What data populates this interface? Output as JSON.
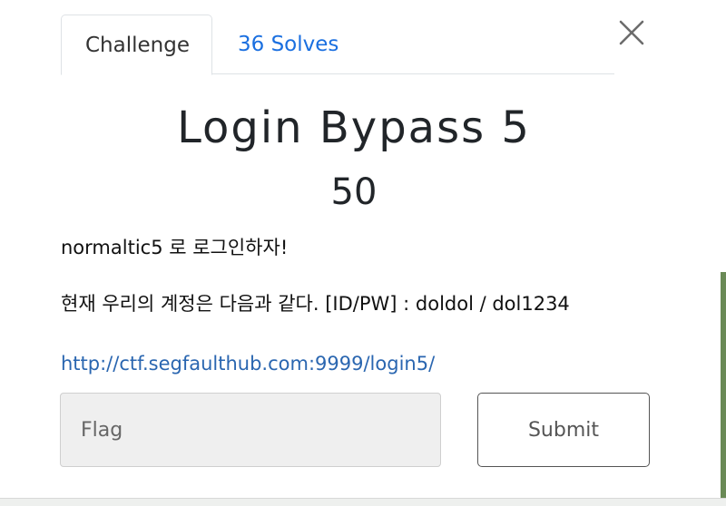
{
  "tabs": {
    "challenge_label": "Challenge",
    "solves_label": "36 Solves"
  },
  "challenge": {
    "title": "Login Bypass 5",
    "points": "50",
    "description_line1": "normaltic5 로 로그인하자!",
    "description_line2": "현재 우리의 계정은 다음과 같다. [ID/PW] : doldol / dol1234",
    "link": "http://ctf.segfaulthub.com:9999/login5/"
  },
  "form": {
    "flag_placeholder": "Flag",
    "submit_label": "Submit"
  },
  "icons": {
    "close": "close-icon"
  },
  "colors": {
    "link_blue": "#1a6fe0",
    "url_blue": "#2a66b0",
    "input_bg": "#efefef"
  }
}
